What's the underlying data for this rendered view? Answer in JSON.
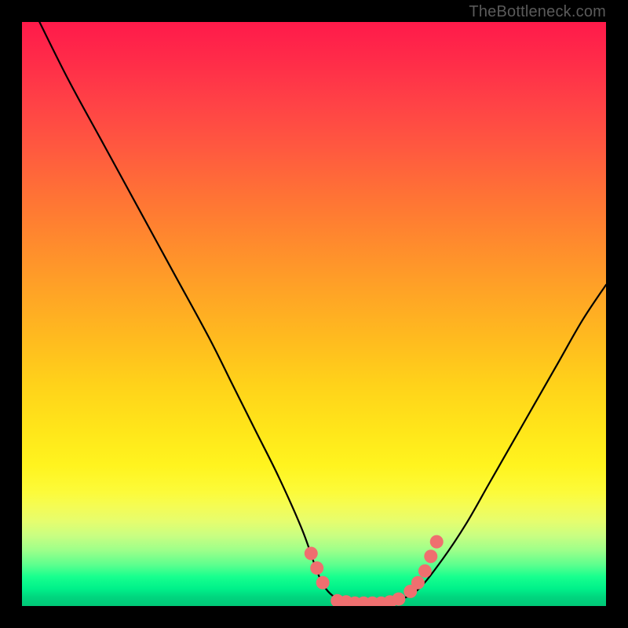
{
  "watermark": "TheBottleneck.com",
  "colors": {
    "background": "#000000",
    "curve_stroke": "#000000",
    "dot_fill": "#ef6f6f",
    "gradient_top": "#ff1a4a",
    "gradient_bottom": "#00c877"
  },
  "chart_data": {
    "type": "line",
    "title": "",
    "xlabel": "",
    "ylabel": "",
    "xlim": [
      0,
      100
    ],
    "ylim": [
      0,
      100
    ],
    "grid": false,
    "legend": false,
    "series": [
      {
        "name": "bottleneck-curve",
        "x": [
          3,
          8,
          14,
          20,
          26,
          32,
          36,
          40,
          44,
          48,
          50.5,
          52,
          54,
          56,
          58,
          60,
          62,
          65,
          68,
          72,
          76,
          80,
          84,
          88,
          92,
          96,
          100
        ],
        "y": [
          100,
          90,
          79,
          68,
          57,
          46,
          38,
          30,
          22,
          13,
          6,
          3,
          1.2,
          0.6,
          0.4,
          0.4,
          0.6,
          1.2,
          3,
          8,
          14,
          21,
          28,
          35,
          42,
          49,
          55
        ]
      }
    ],
    "highlight_points": {
      "name": "flat-region-dots",
      "x": [
        49.5,
        50.5,
        51.5,
        54,
        55.5,
        57,
        58.5,
        60,
        61.5,
        63,
        64.5,
        66.5,
        67.8,
        69,
        70,
        71
      ],
      "y": [
        9,
        6.5,
        4,
        0.9,
        0.7,
        0.5,
        0.5,
        0.5,
        0.5,
        0.7,
        1.2,
        2.5,
        4,
        6,
        8.5,
        11
      ]
    }
  }
}
